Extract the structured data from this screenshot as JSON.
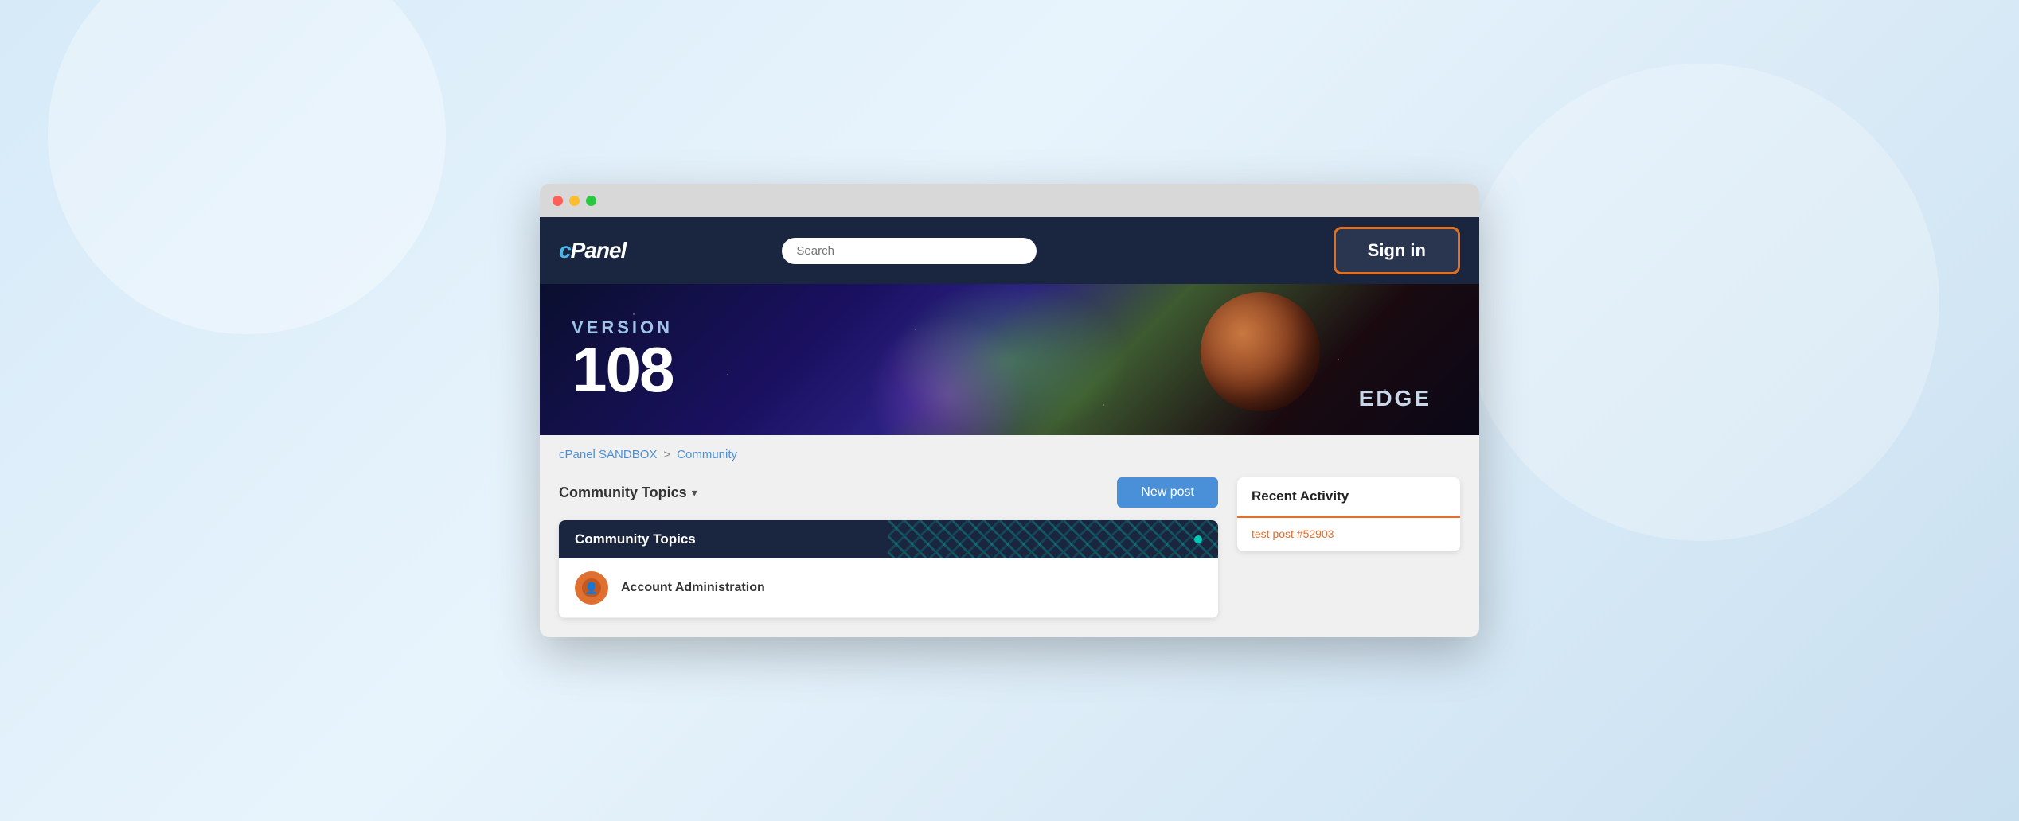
{
  "browser": {
    "traffic_lights": [
      "red",
      "yellow",
      "green"
    ]
  },
  "header": {
    "logo": "cPanel",
    "search_placeholder": "Search",
    "sign_in_label": "Sign in"
  },
  "banner": {
    "version_label": "VERSION",
    "version_number": "108",
    "edge_label": "EDGE"
  },
  "breadcrumb": {
    "root": "cPanel SANDBOX",
    "separator": ">",
    "current": "Community"
  },
  "main": {
    "topics_dropdown_label": "Community Topics",
    "new_post_label": "New post",
    "topics_card": {
      "header": "Community Topics",
      "rows": [
        {
          "name": "Account Administration"
        }
      ]
    }
  },
  "sidebar": {
    "recent_activity_title": "Recent Activity",
    "recent_activity_link": "test post #52903"
  }
}
